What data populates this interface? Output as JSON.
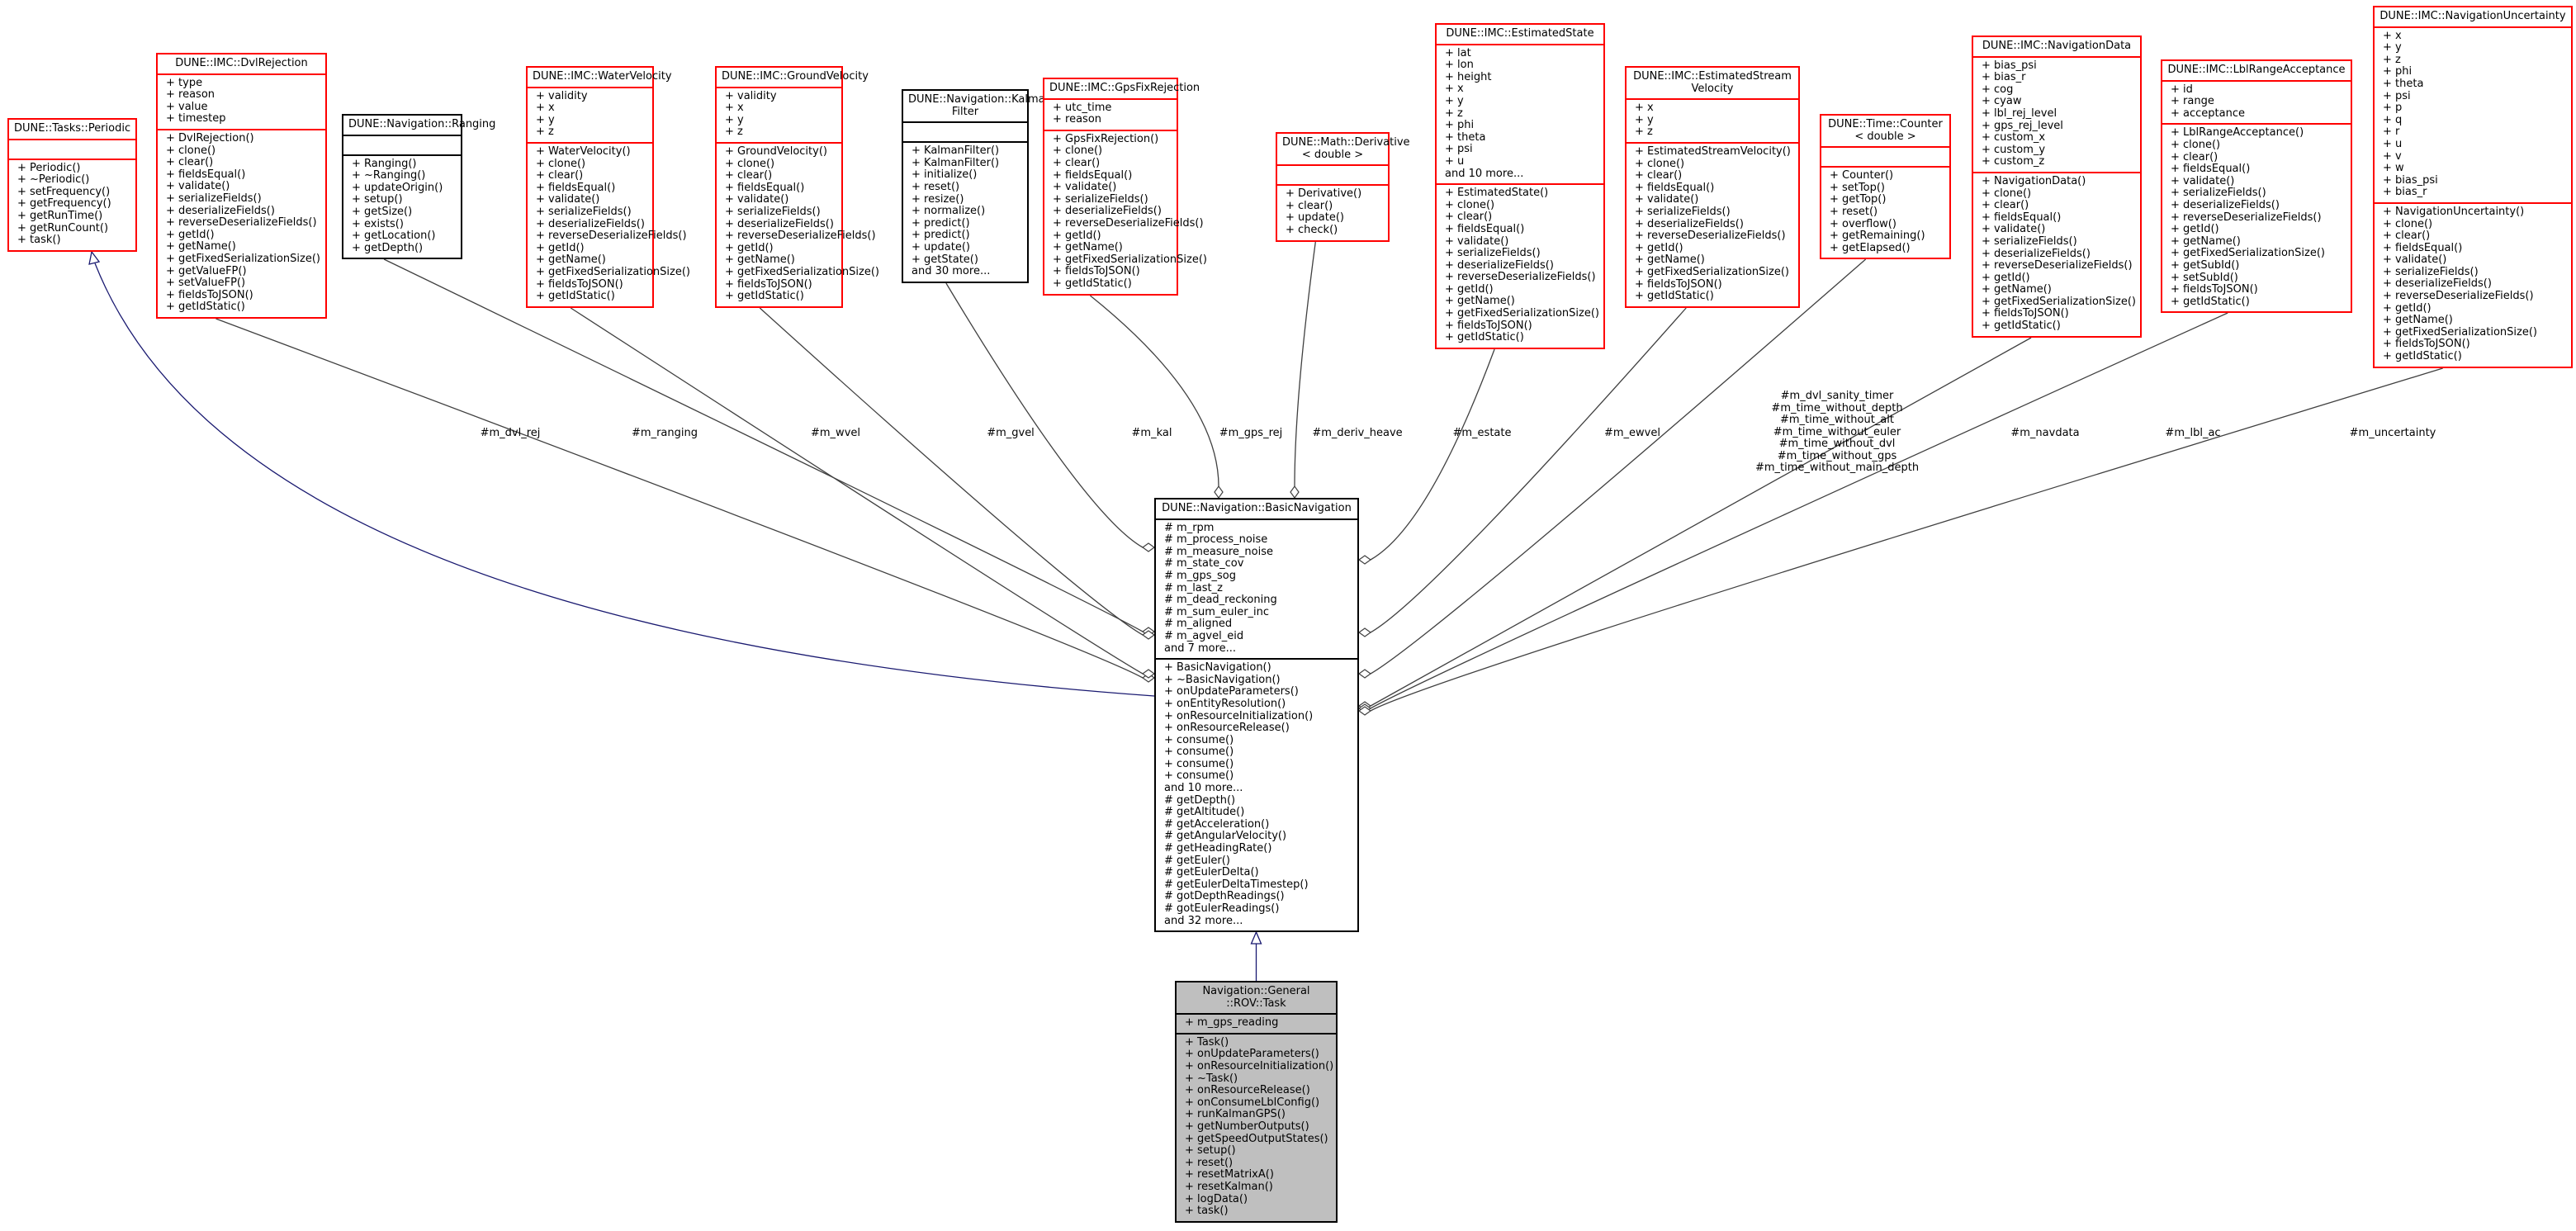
{
  "diagram": {
    "focus_class": "Navigation::General::ROV::Task",
    "colors": {
      "external_border": "#ff0000",
      "internal_border": "#000000",
      "focus_fill": "#bfbfbf",
      "inheritance_edge": "#191970",
      "usage_edge": "#404040"
    },
    "classes": [
      {
        "id": "periodic",
        "title": "DUNE::Tasks::Periodic",
        "style": "red",
        "attributes": [],
        "methods": [
          "+ Periodic()",
          "+ ~Periodic()",
          "+ setFrequency()",
          "+ getFrequency()",
          "+ getRunTime()",
          "+ getRunCount()",
          "+ task()"
        ]
      },
      {
        "id": "dvlrejection",
        "title": "DUNE::IMC::DvlRejection",
        "style": "red",
        "attributes": [
          "+ type",
          "+ reason",
          "+ value",
          "+ timestep"
        ],
        "methods": [
          "+ DvlRejection()",
          "+ clone()",
          "+ clear()",
          "+ fieldsEqual()",
          "+ validate()",
          "+ serializeFields()",
          "+ deserializeFields()",
          "+ reverseDeserializeFields()",
          "+ getId()",
          "+ getName()",
          "+ getFixedSerializationSize()",
          "+ getValueFP()",
          "+ setValueFP()",
          "+ fieldsToJSON()",
          "+ getIdStatic()"
        ]
      },
      {
        "id": "ranging",
        "title": "DUNE::Navigation::Ranging",
        "style": "black",
        "attributes": [],
        "methods": [
          "+ Ranging()",
          "+ ~Ranging()",
          "+ updateOrigin()",
          "+ setup()",
          "+ getSize()",
          "+ exists()",
          "+ getLocation()",
          "+ getDepth()"
        ]
      },
      {
        "id": "watervelocity",
        "title": "DUNE::IMC::WaterVelocity",
        "style": "red",
        "attributes": [
          "+ validity",
          "+ x",
          "+ y",
          "+ z"
        ],
        "methods": [
          "+ WaterVelocity()",
          "+ clone()",
          "+ clear()",
          "+ fieldsEqual()",
          "+ validate()",
          "+ serializeFields()",
          "+ deserializeFields()",
          "+ reverseDeserializeFields()",
          "+ getId()",
          "+ getName()",
          "+ getFixedSerializationSize()",
          "+ fieldsToJSON()",
          "+ getIdStatic()"
        ]
      },
      {
        "id": "groundvelocity",
        "title": "DUNE::IMC::GroundVelocity",
        "style": "red",
        "attributes": [
          "+ validity",
          "+ x",
          "+ y",
          "+ z"
        ],
        "methods": [
          "+ GroundVelocity()",
          "+ clone()",
          "+ clear()",
          "+ fieldsEqual()",
          "+ validate()",
          "+ serializeFields()",
          "+ deserializeFields()",
          "+ reverseDeserializeFields()",
          "+ getId()",
          "+ getName()",
          "+ getFixedSerializationSize()",
          "+ fieldsToJSON()",
          "+ getIdStatic()"
        ]
      },
      {
        "id": "kalman",
        "title": "DUNE::Navigation::Kalman\nFilter",
        "style": "black",
        "attributes": [],
        "methods": [
          "+ KalmanFilter()",
          "+ KalmanFilter()",
          "+ initialize()",
          "+ reset()",
          "+ resize()",
          "+ normalize()",
          "+ predict()",
          "+ predict()",
          "+ update()",
          "+ getState()",
          "and 30 more..."
        ]
      },
      {
        "id": "gpsfixrejection",
        "title": "DUNE::IMC::GpsFixRejection",
        "style": "red",
        "attributes": [
          "+ utc_time",
          "+ reason"
        ],
        "methods": [
          "+ GpsFixRejection()",
          "+ clone()",
          "+ clear()",
          "+ fieldsEqual()",
          "+ validate()",
          "+ serializeFields()",
          "+ deserializeFields()",
          "+ reverseDeserializeFields()",
          "+ getId()",
          "+ getName()",
          "+ getFixedSerializationSize()",
          "+ fieldsToJSON()",
          "+ getIdStatic()"
        ]
      },
      {
        "id": "derivative",
        "title": "DUNE::Math::Derivative\n< double >",
        "style": "red",
        "attributes": [],
        "methods": [
          "+ Derivative()",
          "+ clear()",
          "+ update()",
          "+ check()"
        ]
      },
      {
        "id": "estimatedstate",
        "title": "DUNE::IMC::EstimatedState",
        "style": "red",
        "attributes": [
          "+ lat",
          "+ lon",
          "+ height",
          "+ x",
          "+ y",
          "+ z",
          "+ phi",
          "+ theta",
          "+ psi",
          "+ u",
          "and 10 more..."
        ],
        "methods": [
          "+ EstimatedState()",
          "+ clone()",
          "+ clear()",
          "+ fieldsEqual()",
          "+ validate()",
          "+ serializeFields()",
          "+ deserializeFields()",
          "+ reverseDeserializeFields()",
          "+ getId()",
          "+ getName()",
          "+ getFixedSerializationSize()",
          "+ fieldsToJSON()",
          "+ getIdStatic()"
        ]
      },
      {
        "id": "estimatedstreamvelocity",
        "title": "DUNE::IMC::EstimatedStream\nVelocity",
        "style": "red",
        "attributes": [
          "+ x",
          "+ y",
          "+ z"
        ],
        "methods": [
          "+ EstimatedStreamVelocity()",
          "+ clone()",
          "+ clear()",
          "+ fieldsEqual()",
          "+ validate()",
          "+ serializeFields()",
          "+ deserializeFields()",
          "+ reverseDeserializeFields()",
          "+ getId()",
          "+ getName()",
          "+ getFixedSerializationSize()",
          "+ fieldsToJSON()",
          "+ getIdStatic()"
        ]
      },
      {
        "id": "counter",
        "title": "DUNE::Time::Counter\n< double >",
        "style": "red",
        "attributes": [],
        "methods": [
          "+ Counter()",
          "+ setTop()",
          "+ getTop()",
          "+ reset()",
          "+ overflow()",
          "+ getRemaining()",
          "+ getElapsed()"
        ]
      },
      {
        "id": "navigationdata",
        "title": "DUNE::IMC::NavigationData",
        "style": "red",
        "attributes": [
          "+ bias_psi",
          "+ bias_r",
          "+ cog",
          "+ cyaw",
          "+ lbl_rej_level",
          "+ gps_rej_level",
          "+ custom_x",
          "+ custom_y",
          "+ custom_z"
        ],
        "methods": [
          "+ NavigationData()",
          "+ clone()",
          "+ clear()",
          "+ fieldsEqual()",
          "+ validate()",
          "+ serializeFields()",
          "+ deserializeFields()",
          "+ reverseDeserializeFields()",
          "+ getId()",
          "+ getName()",
          "+ getFixedSerializationSize()",
          "+ fieldsToJSON()",
          "+ getIdStatic()"
        ]
      },
      {
        "id": "lblrangeacceptance",
        "title": "DUNE::IMC::LblRangeAcceptance",
        "style": "red",
        "attributes": [
          "+ id",
          "+ range",
          "+ acceptance"
        ],
        "methods": [
          "+ LblRangeAcceptance()",
          "+ clone()",
          "+ clear()",
          "+ fieldsEqual()",
          "+ validate()",
          "+ serializeFields()",
          "+ deserializeFields()",
          "+ reverseDeserializeFields()",
          "+ getId()",
          "+ getName()",
          "+ getFixedSerializationSize()",
          "+ getSubId()",
          "+ setSubId()",
          "+ fieldsToJSON()",
          "+ getIdStatic()"
        ]
      },
      {
        "id": "navigationuncertainty",
        "title": "DUNE::IMC::NavigationUncertainty",
        "style": "red",
        "attributes": [
          "+ x",
          "+ y",
          "+ z",
          "+ phi",
          "+ theta",
          "+ psi",
          "+ p",
          "+ q",
          "+ r",
          "+ u",
          "+ v",
          "+ w",
          "+ bias_psi",
          "+ bias_r"
        ],
        "methods": [
          "+ NavigationUncertainty()",
          "+ clone()",
          "+ clear()",
          "+ fieldsEqual()",
          "+ validate()",
          "+ serializeFields()",
          "+ deserializeFields()",
          "+ reverseDeserializeFields()",
          "+ getId()",
          "+ getName()",
          "+ getFixedSerializationSize()",
          "+ fieldsToJSON()",
          "+ getIdStatic()"
        ]
      },
      {
        "id": "basicnavigation",
        "title": "DUNE::Navigation::BasicNavigation",
        "style": "black",
        "attributes": [
          "# m_rpm",
          "# m_process_noise",
          "# m_measure_noise",
          "# m_state_cov",
          "# m_gps_sog",
          "# m_last_z",
          "# m_dead_reckoning",
          "# m_sum_euler_inc",
          "# m_aligned",
          "# m_agvel_eid",
          "and 7 more..."
        ],
        "methods": [
          "+ BasicNavigation()",
          "+ ~BasicNavigation()",
          "+ onUpdateParameters()",
          "+ onEntityResolution()",
          "+ onResourceInitialization()",
          "+ onResourceRelease()",
          "+ consume()",
          "+ consume()",
          "+ consume()",
          "+ consume()",
          "and 10 more...",
          "# getDepth()",
          "# getAltitude()",
          "# getAcceleration()",
          "# getAngularVelocity()",
          "# getHeadingRate()",
          "# getEuler()",
          "# getEulerDelta()",
          "# getEulerDeltaTimestep()",
          "# gotDepthReadings()",
          "# gotEulerReadings()",
          "and 32 more..."
        ]
      },
      {
        "id": "rovtask",
        "title": "Navigation::General\n::ROV::Task",
        "style": "focus",
        "attributes": [
          "+ m_gps_reading"
        ],
        "methods": [
          "+ Task()",
          "+ onUpdateParameters()",
          "+ onResourceInitialization()",
          "+ ~Task()",
          "+ onResourceRelease()",
          "+ onConsumeLblConfig()",
          "+ runKalmanGPS()",
          "+ getNumberOutputs()",
          "+ getSpeedOutputStates()",
          "+ setup()",
          "+ reset()",
          "+ resetMatrixA()",
          "+ resetKalman()",
          "+ logData()",
          "+ task()"
        ]
      }
    ],
    "relations": [
      {
        "type": "inheritance",
        "from": "basicnavigation",
        "to": "periodic"
      },
      {
        "type": "inheritance",
        "from": "rovtask",
        "to": "basicnavigation"
      },
      {
        "type": "composition",
        "from": "dvlrejection",
        "to": "basicnavigation",
        "label": "#m_dvl_rej"
      },
      {
        "type": "composition",
        "from": "ranging",
        "to": "basicnavigation",
        "label": "#m_ranging"
      },
      {
        "type": "composition",
        "from": "watervelocity",
        "to": "basicnavigation",
        "label": "#m_wvel"
      },
      {
        "type": "composition",
        "from": "groundvelocity",
        "to": "basicnavigation",
        "label": "#m_gvel"
      },
      {
        "type": "composition",
        "from": "kalman",
        "to": "basicnavigation",
        "label": "#m_kal"
      },
      {
        "type": "composition",
        "from": "gpsfixrejection",
        "to": "basicnavigation",
        "label": "#m_gps_rej"
      },
      {
        "type": "composition",
        "from": "derivative",
        "to": "basicnavigation",
        "label": "#m_deriv_heave"
      },
      {
        "type": "composition",
        "from": "estimatedstate",
        "to": "basicnavigation",
        "label": "#m_estate"
      },
      {
        "type": "composition",
        "from": "estimatedstreamvelocity",
        "to": "basicnavigation",
        "label": "#m_ewvel"
      },
      {
        "type": "composition",
        "from": "counter",
        "to": "basicnavigation",
        "label": "#m_dvl_sanity_timer\n#m_time_without_depth\n#m_time_without_alt\n#m_time_without_euler\n#m_time_without_dvl\n#m_time_without_gps\n#m_time_without_main_depth"
      },
      {
        "type": "composition",
        "from": "navigationdata",
        "to": "basicnavigation",
        "label": "#m_navdata"
      },
      {
        "type": "composition",
        "from": "lblrangeacceptance",
        "to": "basicnavigation",
        "label": "#m_lbl_ac"
      },
      {
        "type": "composition",
        "from": "navigationuncertainty",
        "to": "basicnavigation",
        "label": "#m_uncertainty"
      }
    ]
  }
}
